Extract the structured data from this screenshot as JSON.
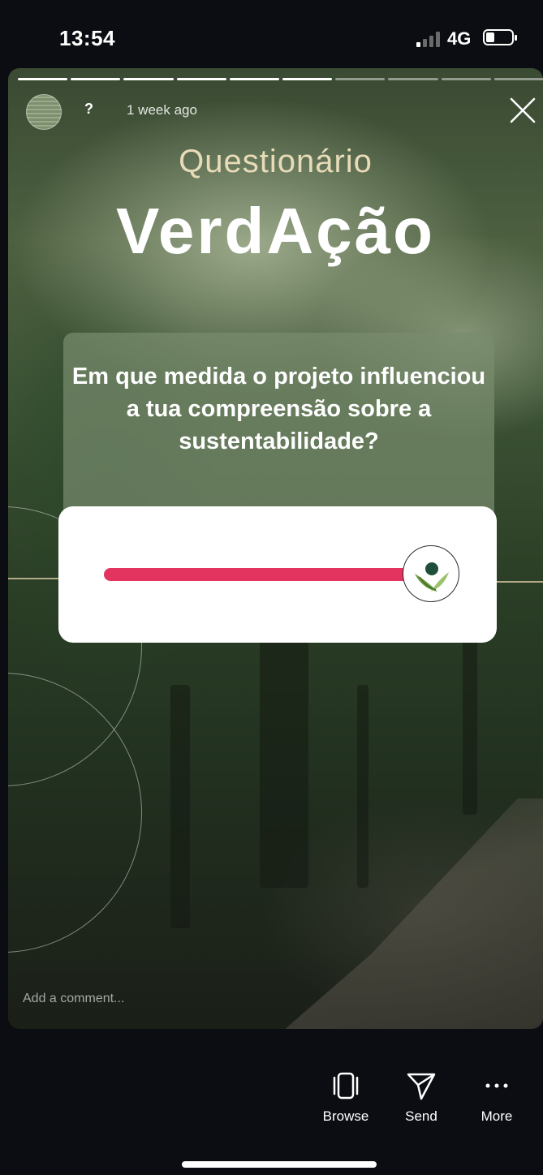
{
  "status_bar": {
    "time": "13:54",
    "network": "4G",
    "battery_level": 0.3
  },
  "story": {
    "progress_segments": 10,
    "progress_done": 6,
    "username": "?",
    "timestamp": "1 week ago",
    "subtitle": "Questionário",
    "title": "VerdAção",
    "question": "Em que medida o projeto influenciou a tua compreensão sobre a sustentabilidade?",
    "slider": {
      "value": 1.0,
      "track_color": "#e3335f"
    },
    "comment_placeholder": "Add a comment..."
  },
  "bottom_bar": {
    "browse_label": "Browse",
    "send_label": "Send",
    "more_label": "More"
  }
}
